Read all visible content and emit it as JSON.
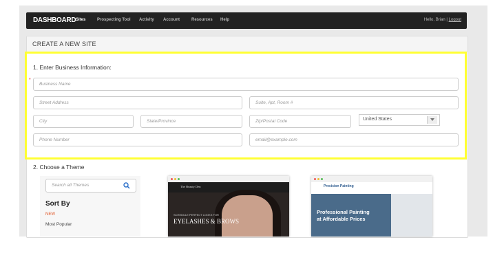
{
  "navbar": {
    "brand": "DASHBOARD",
    "items": [
      {
        "label": "Sites",
        "active": true
      },
      {
        "label": "Prospecting Tool"
      },
      {
        "label": "Activity"
      },
      {
        "label": "Account"
      },
      {
        "label": "Resources"
      },
      {
        "label": "Help"
      }
    ],
    "greeting": "Hello, Brian |",
    "logout": "Logout"
  },
  "panel": {
    "title": "CREATE A NEW SITE"
  },
  "business_info": {
    "heading": "1. Enter Business Information:",
    "required_mark": "*",
    "fields": {
      "business_name": "Business Name",
      "street": "Street Address",
      "suite": "Suite, Apt, Room #",
      "city": "City",
      "state": "State/Province",
      "zip": "Zip/Postal Code",
      "country": "United States",
      "phone": "Phone Number",
      "email": "email@example.com"
    }
  },
  "theme": {
    "heading": "2. Choose a Theme",
    "search_placeholder": "Search all Themes",
    "sort_label": "Sort By",
    "sort_options": [
      "NEW",
      "Most Popular"
    ],
    "thumbnails": [
      {
        "brand": "The Beauty Den",
        "tagline": "SCHEDULE PERFECT LOOKS FOR",
        "headline": "EYELASHES & BROWS"
      },
      {
        "brand": "Precision Painting",
        "headline_line1": "Professional Painting",
        "headline_line2": "at Affordable Prices"
      }
    ]
  },
  "colors": {
    "highlight": "#ffff33",
    "navbar": "#222222",
    "accent_new": "#e05a2b"
  }
}
